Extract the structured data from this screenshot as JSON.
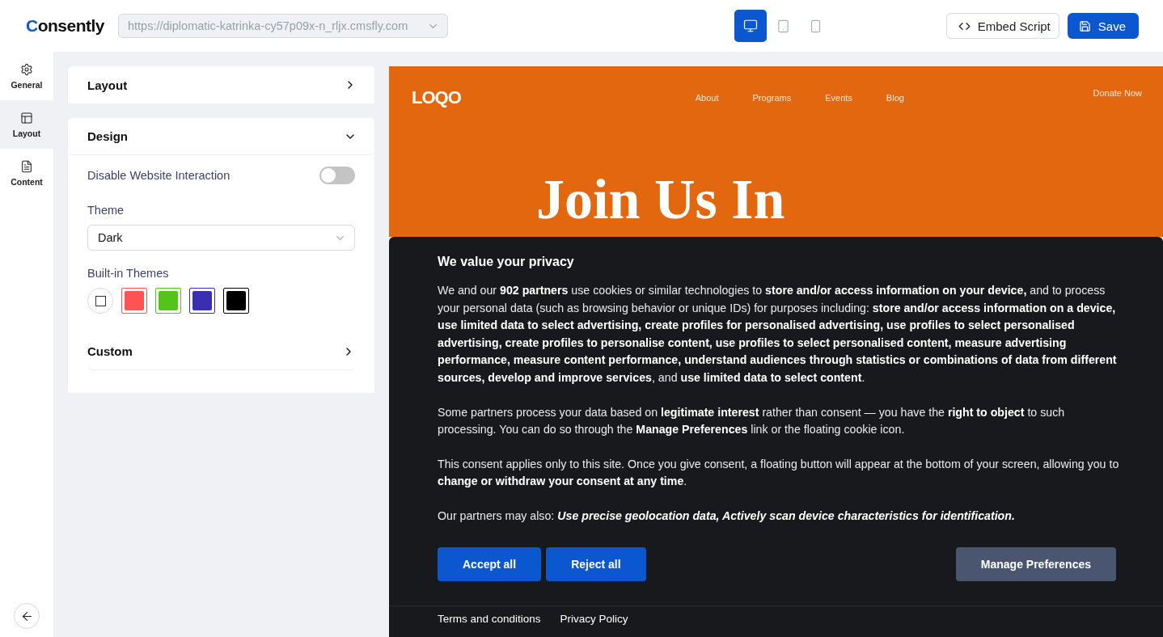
{
  "header": {
    "brand": {
      "mark": "C",
      "rest": "onsently"
    },
    "url": "https://diplomatic-katrinka-cy57p09x-n_rljx.cmsfly.com",
    "devices": [
      {
        "kind": "desktop",
        "selected": true
      },
      {
        "kind": "tablet",
        "selected": false
      },
      {
        "kind": "mobile",
        "selected": false
      }
    ],
    "embed_button": "Embed Script",
    "save_button": "Save"
  },
  "sidebar": {
    "items": [
      {
        "kind": "general",
        "label": "General",
        "selected": false
      },
      {
        "kind": "layout",
        "label": "Layout",
        "selected": true
      },
      {
        "kind": "content",
        "label": "Content",
        "selected": false
      }
    ]
  },
  "settings": {
    "sections": [
      {
        "title": "Layout",
        "expanded": false
      },
      {
        "title": "Design",
        "expanded": true,
        "toggle": {
          "label": "Disable Website Interaction",
          "on": false
        },
        "theme": {
          "label": "Theme",
          "value": "Dark"
        },
        "built_in": {
          "label": "Built-in Themes",
          "swatches": [
            {
              "kind": "default",
              "color": "#ffffff"
            },
            {
              "kind": "swatch",
              "color": "#ff5252"
            },
            {
              "kind": "swatch",
              "color": "#52c41a"
            },
            {
              "kind": "swatch",
              "color": "#3a2fb0"
            },
            {
              "kind": "swatch",
              "color": "#000000"
            }
          ]
        },
        "custom": {
          "title": "Custom",
          "expanded": false
        }
      }
    ]
  },
  "preview": {
    "nav": [
      "About",
      "Programs",
      "Events",
      "Blog"
    ],
    "cta": "Donate Now",
    "logo": "LOQO",
    "hero_title": "Join Us In",
    "banner": {
      "title": "We value your privacy",
      "paragraphs": [
        {
          "text": "We and our **902 partners** use cookies or similar technologies to **store and/or access information on your device,** and to process your personal data (such as browsing behavior or unique IDs) for purposes including: **store and/or access information on a device, use limited data to select advertising, create profiles for personalised advertising, use profiles to select personalised advertising, create profiles to personalise content, use profiles to select personalised content, measure advertising performance, measure content performance, understand audiences through statistics or combinations of data from different sources, develop and improve services**, and **use limited data to select content**."
        },
        {
          "text": "Some partners process your data based on **legitimate interest** rather than consent — you have the **right to object** to such processing. You can do so through the **Manage Preferences** link or the floating cookie icon."
        },
        {
          "text": "This consent applies only to this site. Once you give consent, a floating button will appear at the bottom of your screen, allowing you to **change or withdraw your consent at any time**."
        },
        {
          "text": "Our partners may also: ",
          "emphasis": "Use precise geolocation data, Actively scan device characteristics for identification."
        }
      ],
      "buttons": [
        {
          "kind": "primary",
          "label": "Accept all"
        },
        {
          "kind": "primary",
          "label": "Reject all"
        },
        {
          "kind": "secondary",
          "label": "Manage Preferences"
        }
      ],
      "links": [
        "Terms and conditions",
        "Privacy Policy"
      ]
    }
  }
}
